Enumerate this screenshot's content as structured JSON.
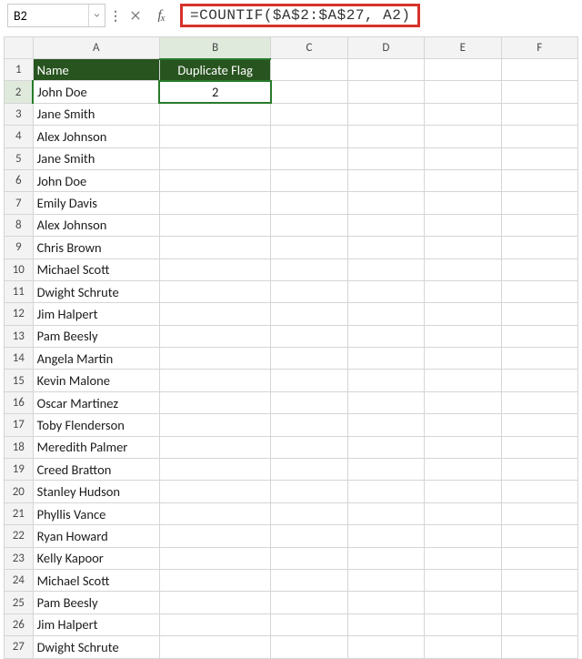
{
  "namebox": {
    "value": "B2"
  },
  "formula_bar": {
    "formula": "=COUNTIF($A$2:$A$27, A2)"
  },
  "col_headers": [
    "A",
    "B",
    "C",
    "D",
    "E",
    "F"
  ],
  "active": {
    "col": "B",
    "row": 2
  },
  "headers": {
    "A": "Name",
    "B": "Duplicate Flag"
  },
  "rows": [
    {
      "n": 1,
      "A": "Name",
      "B": "Duplicate Flag",
      "hdr": true
    },
    {
      "n": 2,
      "A": "John Doe",
      "B": "2"
    },
    {
      "n": 3,
      "A": "Jane Smith",
      "B": ""
    },
    {
      "n": 4,
      "A": "Alex Johnson",
      "B": ""
    },
    {
      "n": 5,
      "A": "Jane Smith",
      "B": ""
    },
    {
      "n": 6,
      "A": "John Doe",
      "B": ""
    },
    {
      "n": 7,
      "A": "Emily Davis",
      "B": ""
    },
    {
      "n": 8,
      "A": "Alex Johnson",
      "B": ""
    },
    {
      "n": 9,
      "A": "Chris Brown",
      "B": ""
    },
    {
      "n": 10,
      "A": "Michael Scott",
      "B": ""
    },
    {
      "n": 11,
      "A": "Dwight Schrute",
      "B": ""
    },
    {
      "n": 12,
      "A": "Jim Halpert",
      "B": ""
    },
    {
      "n": 13,
      "A": "Pam Beesly",
      "B": ""
    },
    {
      "n": 14,
      "A": "Angela Martin",
      "B": ""
    },
    {
      "n": 15,
      "A": "Kevin Malone",
      "B": ""
    },
    {
      "n": 16,
      "A": "Oscar Martinez",
      "B": ""
    },
    {
      "n": 17,
      "A": "Toby Flenderson",
      "B": ""
    },
    {
      "n": 18,
      "A": "Meredith Palmer",
      "B": ""
    },
    {
      "n": 19,
      "A": "Creed Bratton",
      "B": ""
    },
    {
      "n": 20,
      "A": "Stanley Hudson",
      "B": ""
    },
    {
      "n": 21,
      "A": "Phyllis Vance",
      "B": ""
    },
    {
      "n": 22,
      "A": "Ryan Howard",
      "B": ""
    },
    {
      "n": 23,
      "A": "Kelly Kapoor",
      "B": ""
    },
    {
      "n": 24,
      "A": "Michael Scott",
      "B": ""
    },
    {
      "n": 25,
      "A": "Pam Beesly",
      "B": ""
    },
    {
      "n": 26,
      "A": "Jim Halpert",
      "B": ""
    },
    {
      "n": 27,
      "A": "Dwight Schrute",
      "B": ""
    }
  ]
}
